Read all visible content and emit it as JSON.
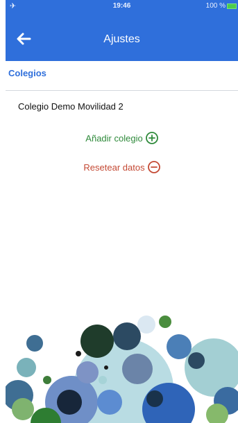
{
  "status": {
    "time": "19:46",
    "battery": "100 %"
  },
  "header": {
    "title": "Ajustes"
  },
  "section": {
    "label": "Colegios"
  },
  "schools": [
    "Colegio Demo Movilidad 2"
  ],
  "actions": {
    "add_label": "Añadir colegio",
    "reset_label": "Resetear datos"
  },
  "icons": {
    "back": "arrow-left-icon",
    "add": "plus-circle-icon",
    "reset": "minus-circle-icon"
  },
  "colors": {
    "primary": "#2f6fdb",
    "add": "#2f8a3b",
    "reset": "#c44934"
  }
}
